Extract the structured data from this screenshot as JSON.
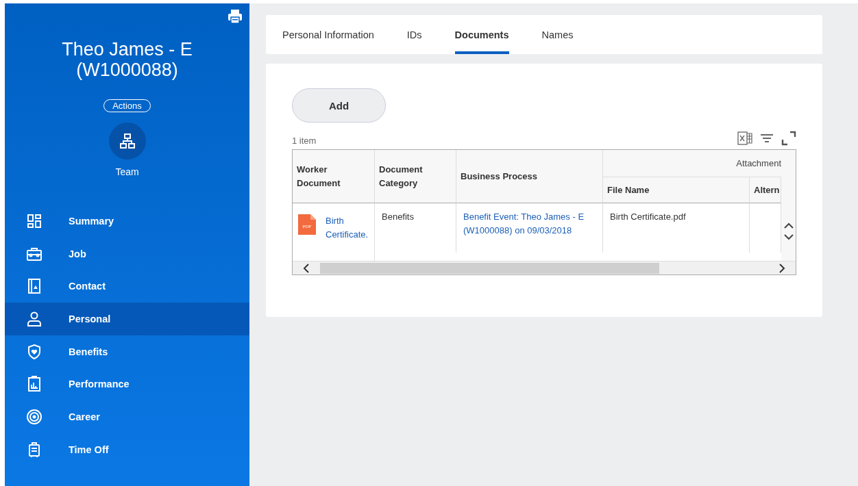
{
  "worker": {
    "name": "Theo James - E (W1000088)",
    "actions_button": "Actions",
    "team_label": "Team"
  },
  "nav": [
    {
      "label": "Summary",
      "selected": false
    },
    {
      "label": "Job",
      "selected": false
    },
    {
      "label": "Contact",
      "selected": false
    },
    {
      "label": "Personal",
      "selected": true
    },
    {
      "label": "Benefits",
      "selected": false
    },
    {
      "label": "Performance",
      "selected": false
    },
    {
      "label": "Career",
      "selected": false
    },
    {
      "label": "Time Off",
      "selected": false
    }
  ],
  "tabs": [
    {
      "label": "Personal Information",
      "selected": false
    },
    {
      "label": "IDs",
      "selected": false
    },
    {
      "label": "Documents",
      "selected": true
    },
    {
      "label": "Names",
      "selected": false
    }
  ],
  "add_button": "Add",
  "item_count": "1 item",
  "table": {
    "group_header": "Attachment",
    "columns": [
      "Worker Document",
      "Document Category",
      "Business Process",
      "File Name",
      "Altern"
    ],
    "rows": [
      {
        "worker_document": "Birth Certificate.",
        "document_category": "Benefits",
        "business_process": "Benefit Event: Theo James - E (W1000088) on 09/03/2018",
        "file_name": "Birth Certificate.pdf",
        "file_badge": "PDF"
      }
    ]
  }
}
